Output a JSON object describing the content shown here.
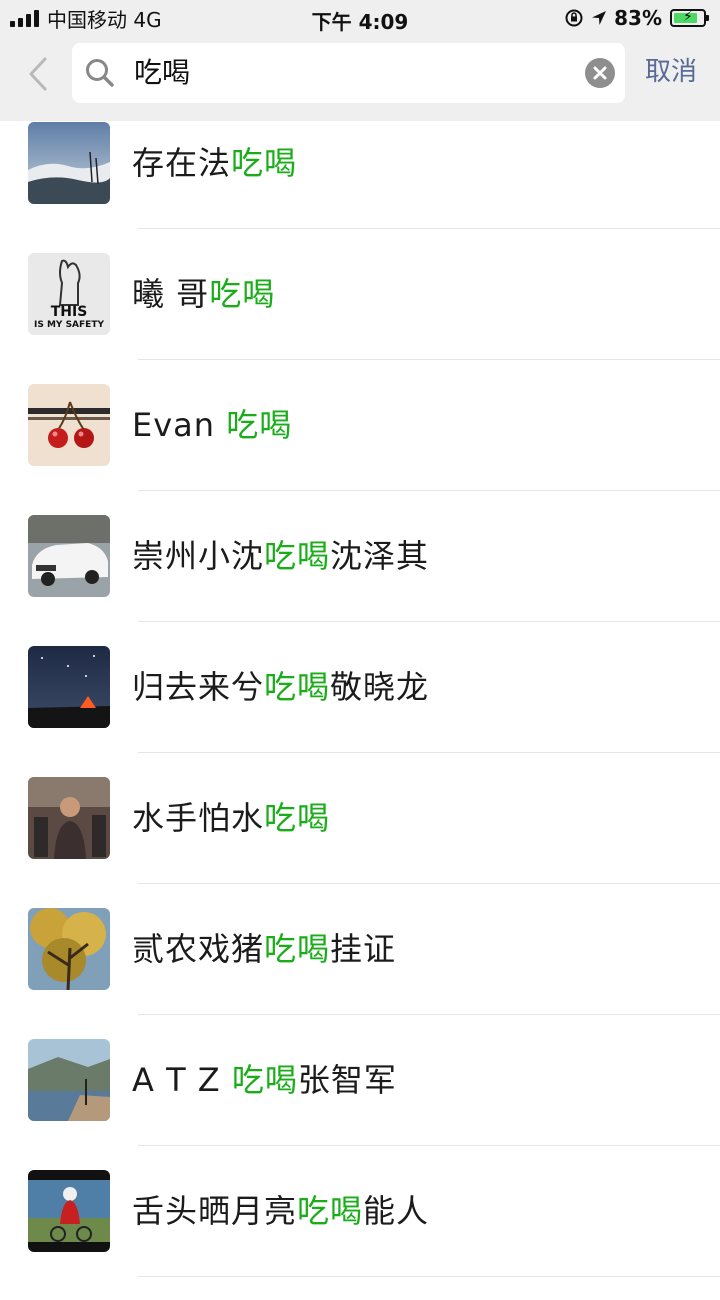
{
  "status_bar": {
    "carrier": "中国移动 4G",
    "time": "下午 4:09",
    "battery": "83%",
    "battery_level": 0.83
  },
  "search": {
    "query": "吃喝",
    "cancel_label": "取消"
  },
  "colors": {
    "highlight": "#1aad19",
    "cancel": "#576b95",
    "header_bg": "#efefef"
  },
  "results": [
    {
      "prefix": "存在法",
      "match": "吃喝",
      "suffix": "",
      "avatar": "misty-mountain-avatar"
    },
    {
      "prefix": "曦 哥",
      "match": "吃喝",
      "suffix": "",
      "avatar": "this-is-my-safety-avatar",
      "avatar_text_1": "THIS",
      "avatar_text_2": "IS MY SAFETY"
    },
    {
      "prefix": "Evan ",
      "match": "吃喝",
      "suffix": "",
      "avatar": "cherries-avatar"
    },
    {
      "prefix": "崇州小沈",
      "match": "吃喝",
      "suffix": "沈泽其",
      "avatar": "white-car-avatar"
    },
    {
      "prefix": "归去来兮",
      "match": "吃喝",
      "suffix": "敬晓龙",
      "avatar": "night-sky-tent-avatar"
    },
    {
      "prefix": "水手怕水",
      "match": "吃喝",
      "suffix": "",
      "avatar": "person-photo-avatar"
    },
    {
      "prefix": "贰农戏猪",
      "match": "吃喝",
      "suffix": "挂证",
      "avatar": "autumn-tree-avatar"
    },
    {
      "prefix": "A T Z ",
      "match": "吃喝",
      "suffix": "张智军",
      "avatar": "lakeside-avatar"
    },
    {
      "prefix": "舌头晒月亮",
      "match": "吃喝",
      "suffix": "能人",
      "avatar": "cyclist-avatar"
    }
  ]
}
